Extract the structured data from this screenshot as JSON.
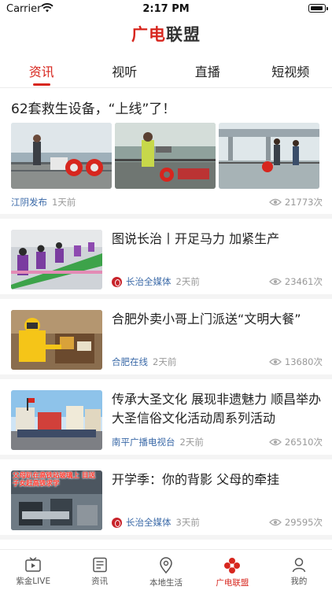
{
  "status_bar": {
    "carrier": "Carrier",
    "time": "2:17 PM"
  },
  "app": {
    "logo_part1": "广电",
    "logo_part2": "联盟"
  },
  "top_tabs": [
    {
      "label": "资讯",
      "active": true
    },
    {
      "label": "视听",
      "active": false
    },
    {
      "label": "直播",
      "active": false
    },
    {
      "label": "短视频",
      "active": false
    }
  ],
  "feed": [
    {
      "title": "62套救生设备，“上线”了！",
      "source": "江阴发布",
      "age": "1天前",
      "views": "21773次",
      "layout": "three-images"
    },
    {
      "title": "图说长治丨开足马力 加紧生产",
      "source": "长治全媒体",
      "age": "2天前",
      "views": "23461次",
      "layout": "left-image",
      "source_badge": true
    },
    {
      "title": "合肥外卖小哥上门派送“文明大餐”",
      "source": "合肥在线",
      "age": "2天前",
      "views": "13680次",
      "layout": "left-image"
    },
    {
      "title": "传承大圣文化 展现非遗魅力 顺昌举办大圣信俗文化活动周系列活动",
      "source": "南平广播电视台",
      "age": "2天前",
      "views": "26510次",
      "layout": "left-image"
    },
    {
      "title": "开学季：你的背影 父母的牵挂",
      "source": "长治全媒体",
      "age": "3天前",
      "views": "29595次",
      "layout": "left-image",
      "source_badge": true,
      "image_caption": "父母趴在高铁站玻璃上 目送子女赶高铁求学"
    }
  ],
  "bottom_nav": [
    {
      "label": "紫金LIVE",
      "icon": "tv-play-icon",
      "active": false
    },
    {
      "label": "资讯",
      "icon": "news-list-icon",
      "active": false
    },
    {
      "label": "本地生活",
      "icon": "location-pin-icon",
      "active": false
    },
    {
      "label": "广电联盟",
      "icon": "alliance-flower-icon",
      "active": true
    },
    {
      "label": "我的",
      "icon": "user-icon",
      "active": false
    }
  ],
  "colors": {
    "accent": "#d7261e",
    "source_link": "#3b6aa8",
    "muted": "#999999"
  }
}
